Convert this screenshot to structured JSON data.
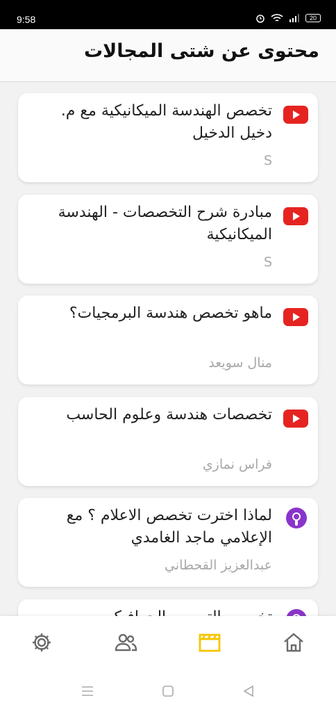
{
  "status": {
    "time": "9:58",
    "battery": "20"
  },
  "header": {
    "title": "محتوى عن شتى المجالات"
  },
  "cards": [
    {
      "type": "youtube",
      "icon": "youtube-icon",
      "title": "تخصص الهندسة الميكانيكية مع م. دخيل الدخيل",
      "author": "S"
    },
    {
      "type": "youtube",
      "icon": "youtube-icon",
      "title": "مبادرة شرح التخصصات - الهندسة الميكانيكية",
      "author": "S"
    },
    {
      "type": "youtube",
      "icon": "youtube-icon",
      "title": "ماهو تخصص هندسة البرمجيات؟",
      "author": "منال سويعد"
    },
    {
      "type": "youtube",
      "icon": "youtube-icon",
      "title": "تخصصات هندسة وعلوم الحاسب",
      "author": "فراس نمازي"
    },
    {
      "type": "podcast",
      "icon": "podcast-icon",
      "title": "لماذا اخترت تخصص الاعلام ؟ مع الإعلامي ماجد الغامدي",
      "author": "عبدالعزيز القحطاني"
    },
    {
      "type": "podcast",
      "icon": "podcast-icon",
      "title": "تخصص التصميم الجرافيكي",
      "author": ""
    }
  ],
  "nav": {
    "items": [
      "settings",
      "people",
      "content",
      "home"
    ],
    "active": "content",
    "active_color": "#f6c500",
    "inactive_color": "#6b6b6b"
  },
  "colors": {
    "youtube": "#e52421",
    "podcast": "#8a35c9"
  }
}
